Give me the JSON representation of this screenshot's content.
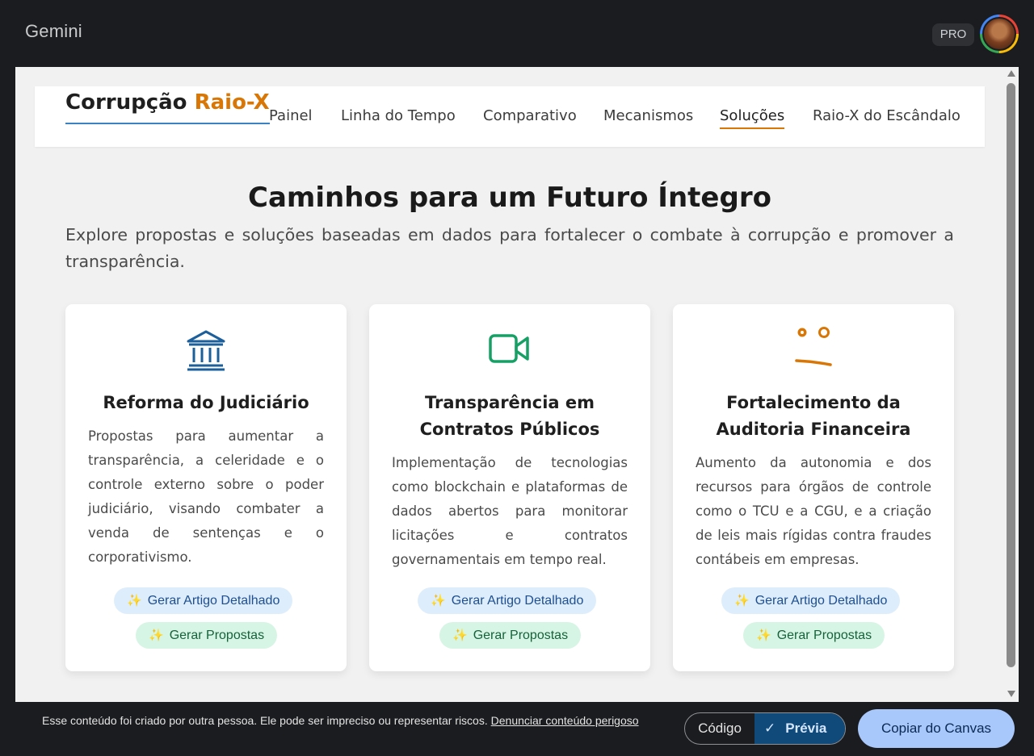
{
  "app": {
    "name": "Gemini",
    "badge": "PRO"
  },
  "site": {
    "title_main": "Corrupção",
    "title_accent": "Raio-X",
    "nav": [
      "Painel",
      "Linha do Tempo",
      "Comparativo",
      "Mecanismos",
      "Soluções",
      "Raio-X do Escândalo"
    ],
    "active_nav": "Soluções"
  },
  "hero": {
    "title": "Caminhos para um Futuro Íntegro",
    "subtitle": "Explore propostas e soluções baseadas em dados para fortalecer o combate à corrupção e promover a transparência."
  },
  "cards": [
    {
      "icon": "bank-icon",
      "title": "Reforma do Judiciário",
      "text": "Propostas para aumentar a transparência, a celeridade e o controle externo sobre o poder judiciário, visando combater a venda de sentenças e o corporativismo.",
      "btn_article": "Gerar Artigo Detalhado",
      "btn_proposals": "Gerar Propostas"
    },
    {
      "icon": "video-camera-icon",
      "title": "Transparência em Contratos Públicos",
      "text": "Implementação de tecnologias como blockchain e plataformas de dados abertos para monitorar licitações e contratos governamentais em tempo real.",
      "btn_article": "Gerar Artigo Detalhado",
      "btn_proposals": "Gerar Propostas"
    },
    {
      "icon": "face-icon",
      "title": "Fortalecimento da Auditoria Financeira",
      "text": "Aumento da autonomia e dos recursos para órgãos de controle como o TCU e a CGU, e a criação de leis mais rígidas contra fraudes contábeis em empresas.",
      "btn_article": "Gerar Artigo Detalhado",
      "btn_proposals": "Gerar Propostas"
    }
  ],
  "footer": {
    "disclaimer": "Esse conteúdo foi criado por outra pessoa. Ele pode ser impreciso ou representar riscos.",
    "report_link": "Denunciar conteúdo perigoso",
    "toggle_code": "Código",
    "toggle_preview": "Prévia",
    "copy_button": "Copiar do Canvas"
  },
  "colors": {
    "accent_orange": "#d97706",
    "nav_underline_blue": "#3a82c4",
    "icon_blue": "#1d5f9a",
    "icon_green": "#16a065",
    "icon_orange": "#d97706",
    "copy_button_bg": "#a8c7fa"
  }
}
